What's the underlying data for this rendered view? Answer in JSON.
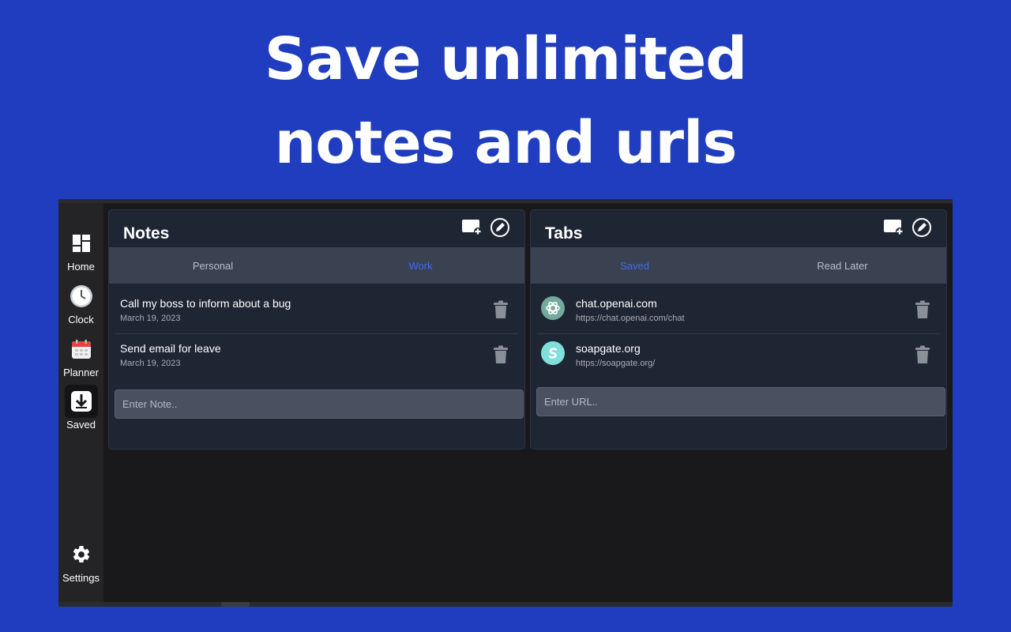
{
  "headline": {
    "line1": "Save unlimited",
    "line2": "notes and urls"
  },
  "sidebar": {
    "items": [
      {
        "label": "Home",
        "icon": "dashboard-icon"
      },
      {
        "label": "Clock",
        "icon": "clock-icon"
      },
      {
        "label": "Planner",
        "icon": "calendar-icon"
      },
      {
        "label": "Saved",
        "icon": "download-icon",
        "active": true
      }
    ],
    "settings": {
      "label": "Settings",
      "icon": "gear-icon"
    }
  },
  "notes": {
    "title": "Notes",
    "tabs": [
      {
        "label": "Personal",
        "active": false
      },
      {
        "label": "Work",
        "active": true
      }
    ],
    "items": [
      {
        "text": "Call my boss to inform about a bug",
        "date": "March 19, 2023"
      },
      {
        "text": "Send email for leave",
        "date": "March 19, 2023"
      }
    ],
    "input_placeholder": "Enter Note.."
  },
  "tabs": {
    "title": "Tabs",
    "tabs": [
      {
        "label": "Saved",
        "active": true
      },
      {
        "label": "Read Later",
        "active": false
      }
    ],
    "items": [
      {
        "title": "chat.openai.com",
        "url": "https://chat.openai.com/chat",
        "icon": "openai-logo-icon",
        "icon_color": "#74aa9c"
      },
      {
        "title": "soapgate.org",
        "url": "https://soapgate.org/",
        "icon": "soapgate-logo-icon",
        "icon_color": "#7fe0dc"
      }
    ],
    "input_placeholder": "Enter URL.."
  },
  "colors": {
    "background": "#1f3dbe",
    "active_tab": "#3d6cf0",
    "panel": "#1f2633"
  }
}
